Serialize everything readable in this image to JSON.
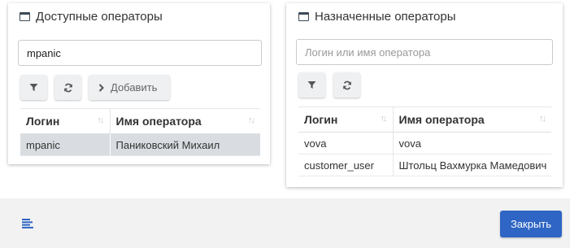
{
  "available": {
    "title": "Доступные операторы",
    "search_value": "mpanic",
    "add_label": "Добавить",
    "columns": [
      "Логин",
      "Имя оператора"
    ],
    "rows": [
      {
        "login": "mpanic",
        "name": "Паниковский Михаил",
        "selected": true
      }
    ]
  },
  "assigned": {
    "title": "Назначенные операторы",
    "search_value": "",
    "search_placeholder": "Логин или имя оператора",
    "columns": [
      "Логин",
      "Имя оператора"
    ],
    "rows": [
      {
        "login": "vova",
        "name": "vova"
      },
      {
        "login": "customer_user",
        "name": "Штольц Вахмурка Мамедович"
      }
    ]
  },
  "footer": {
    "close_label": "Закрыть"
  },
  "colors": {
    "primary": "#2f65c4",
    "selected_row": "#d9dde1",
    "footer_bg": "#f2f2f2"
  },
  "icons": {
    "panel_icon": "window-icon",
    "filter": "filter-icon",
    "refresh": "refresh-icon",
    "add": "chevron-right-icon",
    "sort": "sort-icon",
    "menu": "menu-lines-icon"
  }
}
